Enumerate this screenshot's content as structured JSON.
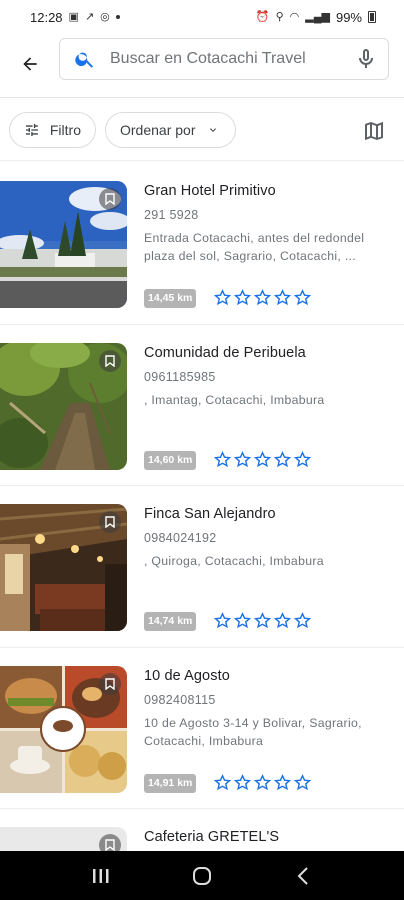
{
  "status_bar": {
    "time": "12:28",
    "battery": "99%"
  },
  "search": {
    "placeholder": "Buscar en Cotacachi Travel"
  },
  "filters": {
    "filter_label": "Filtro",
    "sort_label": "Ordenar por"
  },
  "places": [
    {
      "name": "Gran Hotel Primitivo",
      "phone": "291 5928",
      "address": "Entrada Cotacachi, antes del redondel plaza del sol, Sagrario, Cotacachi, ...",
      "distance": "14,45 km",
      "rating": 0
    },
    {
      "name": "Comunidad de Peribuela",
      "phone": "0961185985",
      "address": ", Imantag, Cotacachi, Imbabura",
      "distance": "14,60 km",
      "rating": 0
    },
    {
      "name": "Finca San Alejandro",
      "phone": "0984024192",
      "address": ", Quiroga, Cotacachi, Imbabura",
      "distance": "14,74 km",
      "rating": 0
    },
    {
      "name": "10 de Agosto",
      "phone": "0982408115",
      "address": "10 de Agosto 3-14 y Bolivar, Sagrario, Cotacachi, Imbabura",
      "distance": "14,91 km",
      "rating": 0
    },
    {
      "name": "Cafeteria GRETEL'S"
    }
  ],
  "icons": {
    "accent": "#1a73e8"
  }
}
